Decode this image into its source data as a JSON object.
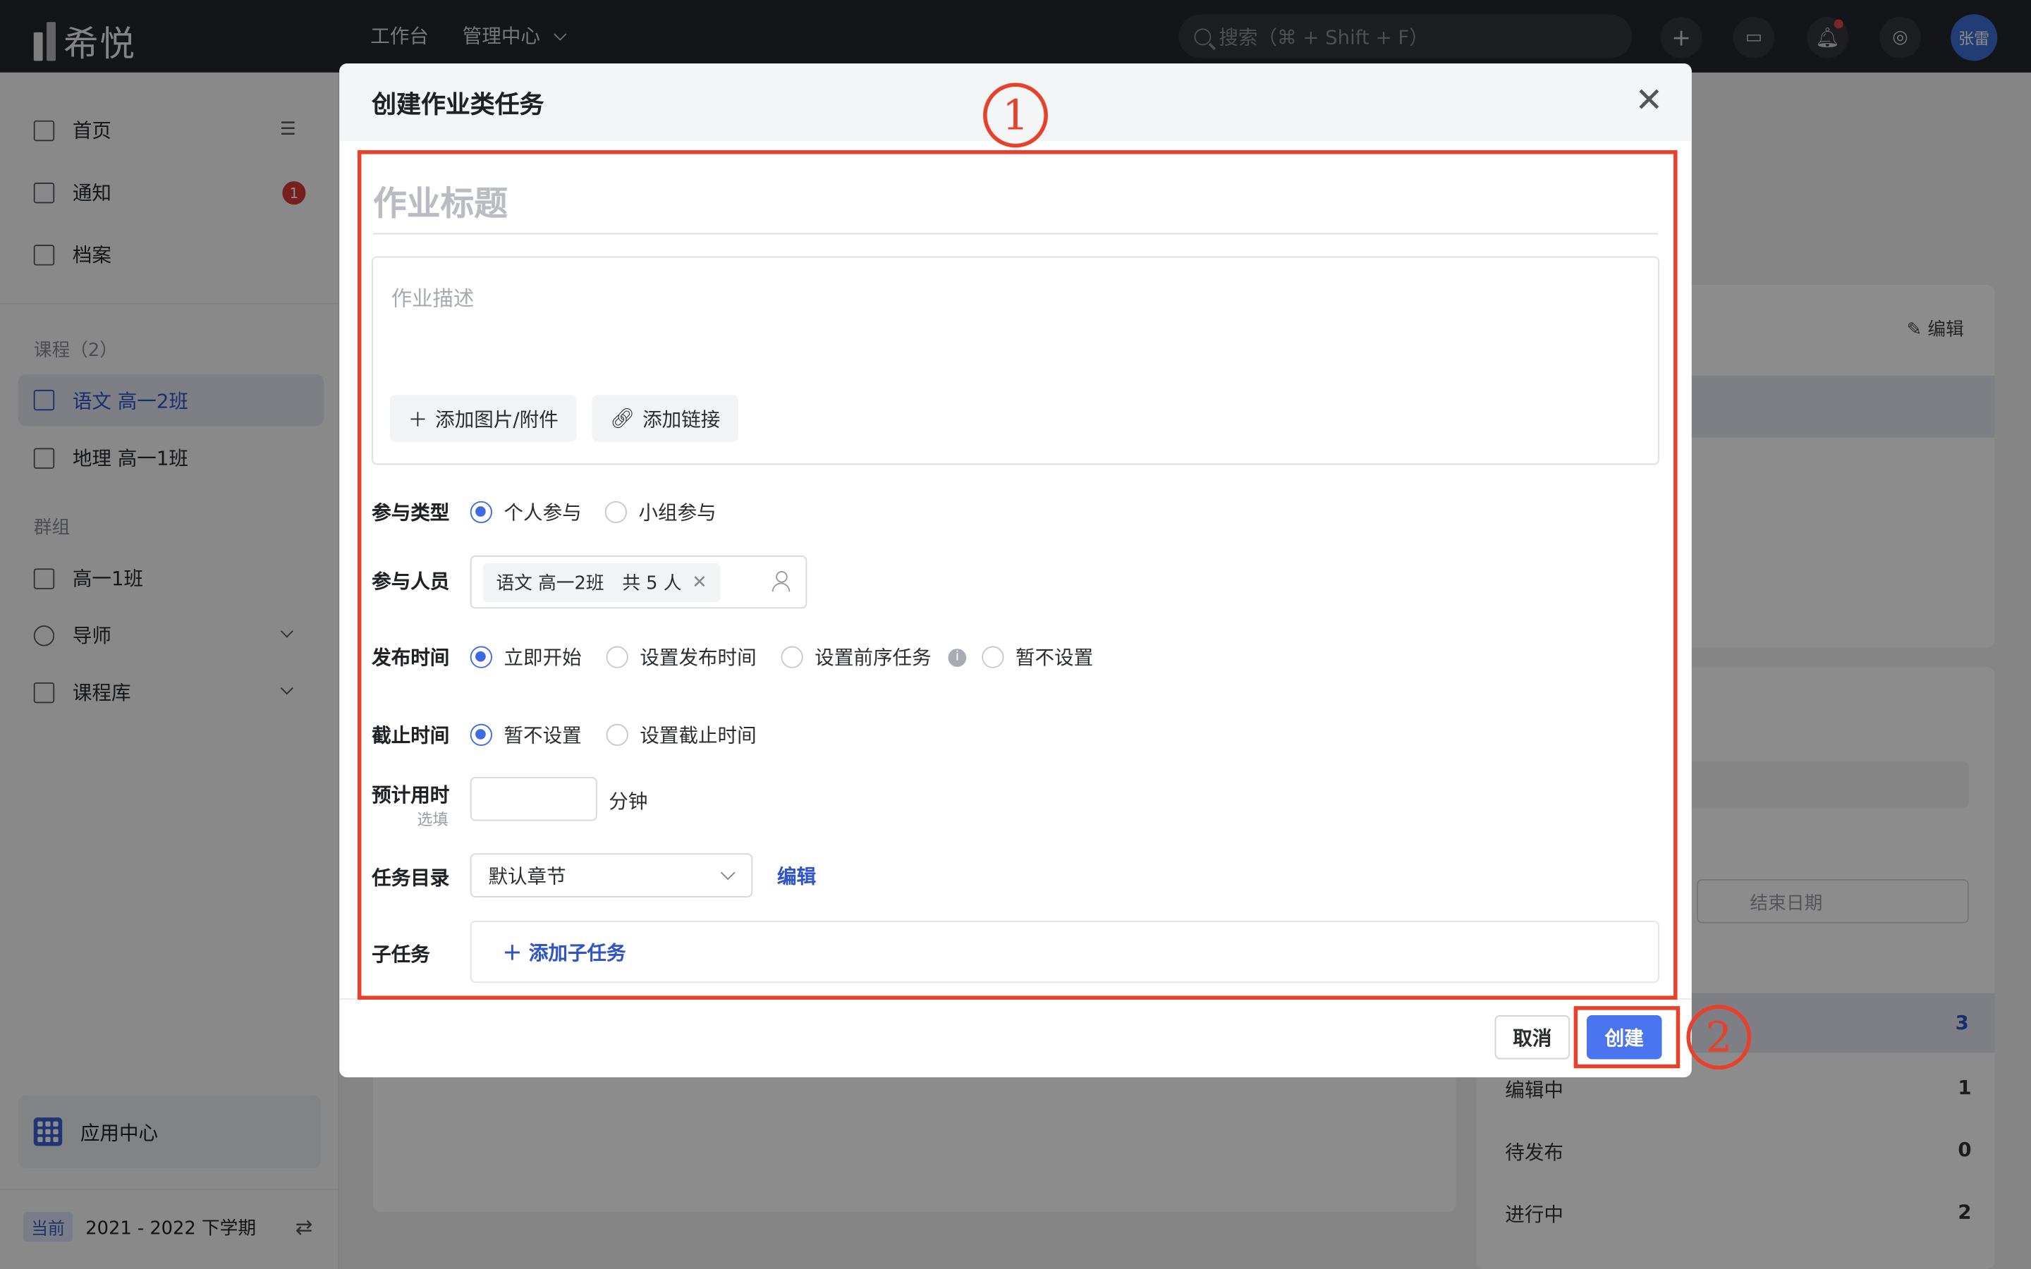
{
  "topbar": {
    "logo_text": "希悦",
    "nav": [
      "工作台",
      "管理中心"
    ],
    "search_placeholder": "搜索（⌘ + Shift + F）",
    "user_name": "张雷"
  },
  "sidebar": {
    "home": "首页",
    "notify": "通知",
    "notify_count": "1",
    "archive": "档案",
    "courses_label": "课程（2）",
    "courses": [
      "语文 高一2班",
      "地理 高一1班"
    ],
    "groups_label": "群组",
    "groups": [
      "高一1班",
      "导师",
      "课程库"
    ],
    "app_center": "应用中心",
    "term_tag": "当前",
    "term": "2021 - 2022 下学期"
  },
  "background": {
    "edit": "编辑",
    "end_date_placeholder": "结束日期",
    "stats": [
      {
        "label": "编辑中",
        "value": "1"
      },
      {
        "label": "待发布",
        "value": "0"
      },
      {
        "label": "进行中",
        "value": "2"
      }
    ],
    "top_stat_value": "3"
  },
  "modal": {
    "title": "创建作业类任务",
    "title_placeholder": "作业标题",
    "desc_placeholder": "作业描述",
    "add_attachment": "添加图片/附件",
    "add_link": "添加链接",
    "participation": {
      "label": "参与类型",
      "options": [
        "个人参与",
        "小组参与"
      ],
      "selected": "个人参与"
    },
    "members": {
      "label": "参与人员",
      "tag": "语文 高一2班　共 5 人"
    },
    "publish": {
      "label": "发布时间",
      "options": [
        "立即开始",
        "设置发布时间",
        "设置前序任务",
        "暂不设置"
      ],
      "selected": "立即开始"
    },
    "deadline": {
      "label": "截止时间",
      "options": [
        "暂不设置",
        "设置截止时间"
      ],
      "selected": "暂不设置"
    },
    "estimate": {
      "label": "预计用时",
      "optional": "选填",
      "unit": "分钟"
    },
    "catalog": {
      "label": "任务目录",
      "value": "默认章节",
      "edit": "编辑"
    },
    "subtask": {
      "label": "子任务",
      "add": "添加子任务"
    },
    "cancel": "取消",
    "create": "创建"
  },
  "annotations": {
    "step1": "1",
    "step2": "2",
    "color": "#e8402b"
  }
}
